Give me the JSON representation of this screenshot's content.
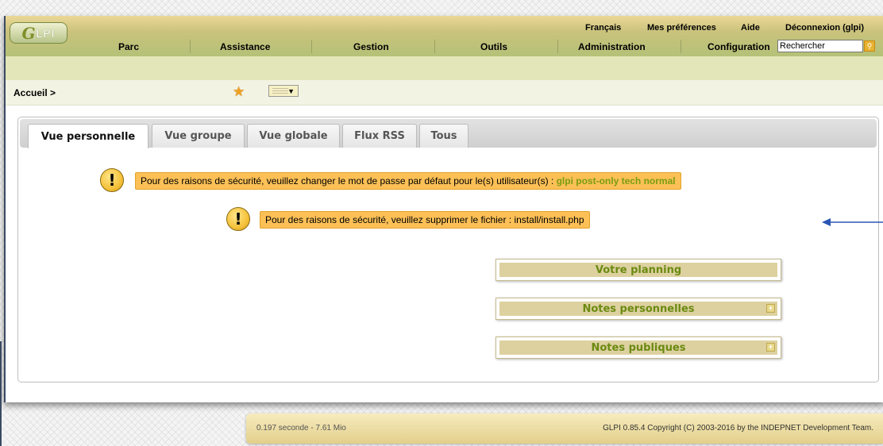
{
  "header": {
    "logo": {
      "letter": "G",
      "text": "LPI"
    },
    "top_links": [
      "Français",
      "Mes préférences",
      "Aide",
      "Déconnexion (glpi)"
    ],
    "menu": [
      "Parc",
      "Assistance",
      "Gestion",
      "Outils",
      "Administration",
      "Configuration"
    ],
    "search": {
      "value": "Rechercher",
      "button_icon": "search-icon"
    }
  },
  "breadcrumb": {
    "label": "Accueil >",
    "bookmark_icon": "star-icon",
    "display_icon": "display-toggle-icon"
  },
  "tabs": [
    "Vue personnelle",
    "Vue groupe",
    "Vue globale",
    "Flux RSS",
    "Tous"
  ],
  "active_tab": "Vue personnelle",
  "warnings": [
    {
      "icon": "warning-icon",
      "text": "Pour des raisons de sécurité, veuillez changer le mot de passe par défaut pour le(s) utilisateur(s) : ",
      "users": "glpi post-only tech normal"
    },
    {
      "icon": "warning-icon",
      "text": "Pour des raisons de sécurité, veuillez supprimer le fichier : install/install.php"
    }
  ],
  "cards": [
    {
      "title": "Votre planning"
    },
    {
      "title": "Notes personnelles",
      "add_icon": "add-icon"
    },
    {
      "title": "Notes publiques",
      "add_icon": "add-icon"
    }
  ],
  "footer": {
    "time": "0.197 seconde - 7.61 Mio",
    "copyright": "GLPI 0.85.4 Copyright (C) 2003-2016 by the INDEPNET Development Team."
  },
  "annotation": {
    "icon": "arrow-left-icon",
    "color": "#2a56b4"
  },
  "colors": {
    "warning_bg": "#fcc056",
    "card_title": "#6a8a10",
    "header": "#c9c27c"
  }
}
